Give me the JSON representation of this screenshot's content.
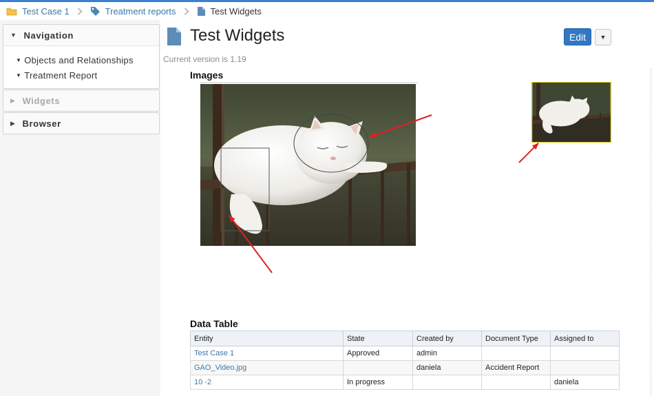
{
  "breadcrumb": [
    {
      "label": "Test Case 1",
      "icon": "folder-icon"
    },
    {
      "label": "Treatment reports",
      "icon": "tag-icon"
    },
    {
      "label": "Test Widgets",
      "icon": "document-icon"
    }
  ],
  "sidebar": {
    "navigation": {
      "title": "Navigation",
      "items": [
        {
          "label": "Objects and Relationships"
        },
        {
          "label": "Treatment Report"
        }
      ]
    },
    "widgets": {
      "title": "Widgets"
    },
    "browser": {
      "title": "Browser"
    }
  },
  "page": {
    "title": "Test Widgets",
    "edit_label": "Edit",
    "version_text": "Current version is 1.19",
    "images_title": "Images",
    "table_title": "Data Table"
  },
  "table": {
    "columns": [
      "Entity",
      "State",
      "Created by",
      "Document Type",
      "Assigned to"
    ],
    "rows": [
      {
        "entity": "Test Case 1",
        "state": "Approved",
        "created_by": "admin",
        "document_type": "",
        "assigned_to": ""
      },
      {
        "entity": "GAO_Video.jpg",
        "state": "",
        "created_by": "daniela",
        "document_type": "Accident Report",
        "assigned_to": ""
      },
      {
        "entity": "10 -2",
        "state": "In progress",
        "created_by": "",
        "document_type": "",
        "assigned_to": "daniela"
      }
    ]
  },
  "colors": {
    "accent": "#2f78c4",
    "link": "#3a78a8",
    "annotation_arrow": "#e02020",
    "thumbnail_border": "#d6c400"
  }
}
